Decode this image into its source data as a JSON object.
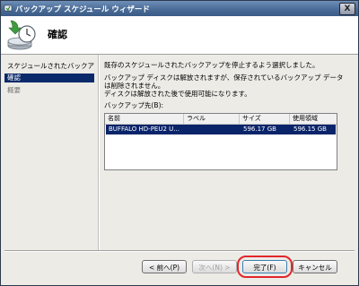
{
  "window": {
    "title": "バックアップ スケジュール ウィザード",
    "close_glyph": "X"
  },
  "header": {
    "title": "確認"
  },
  "sidebar": {
    "items": [
      {
        "label": "スケジュールされたバックア..."
      },
      {
        "label": "確認",
        "selected": true
      },
      {
        "label": "概要"
      }
    ]
  },
  "content": {
    "line1": "既存のスケジュールされたバックアップを停止するよう選択しました。",
    "line2": "バックアップ ディスクは解放されますが、保存されているバックアップ データは削除されません。",
    "line3": "ディスクは解放された後で使用可能になります。",
    "dest_label": "バックアップ先(B):"
  },
  "list": {
    "columns": [
      "名前",
      "ラベル",
      "サイズ",
      "使用領域"
    ],
    "rows": [
      {
        "name": "BUFFALO HD-PEU2 U...",
        "label": "",
        "size": "596.17 GB",
        "used": "596.15 GB"
      }
    ]
  },
  "buttons": {
    "back": "< 前へ(P)",
    "next": "次へ(N) >",
    "finish": "完了(F)",
    "cancel": "キャンセル"
  },
  "colors": {
    "selection": "#0a2a6b",
    "highlight_ring": "#e2262b"
  }
}
